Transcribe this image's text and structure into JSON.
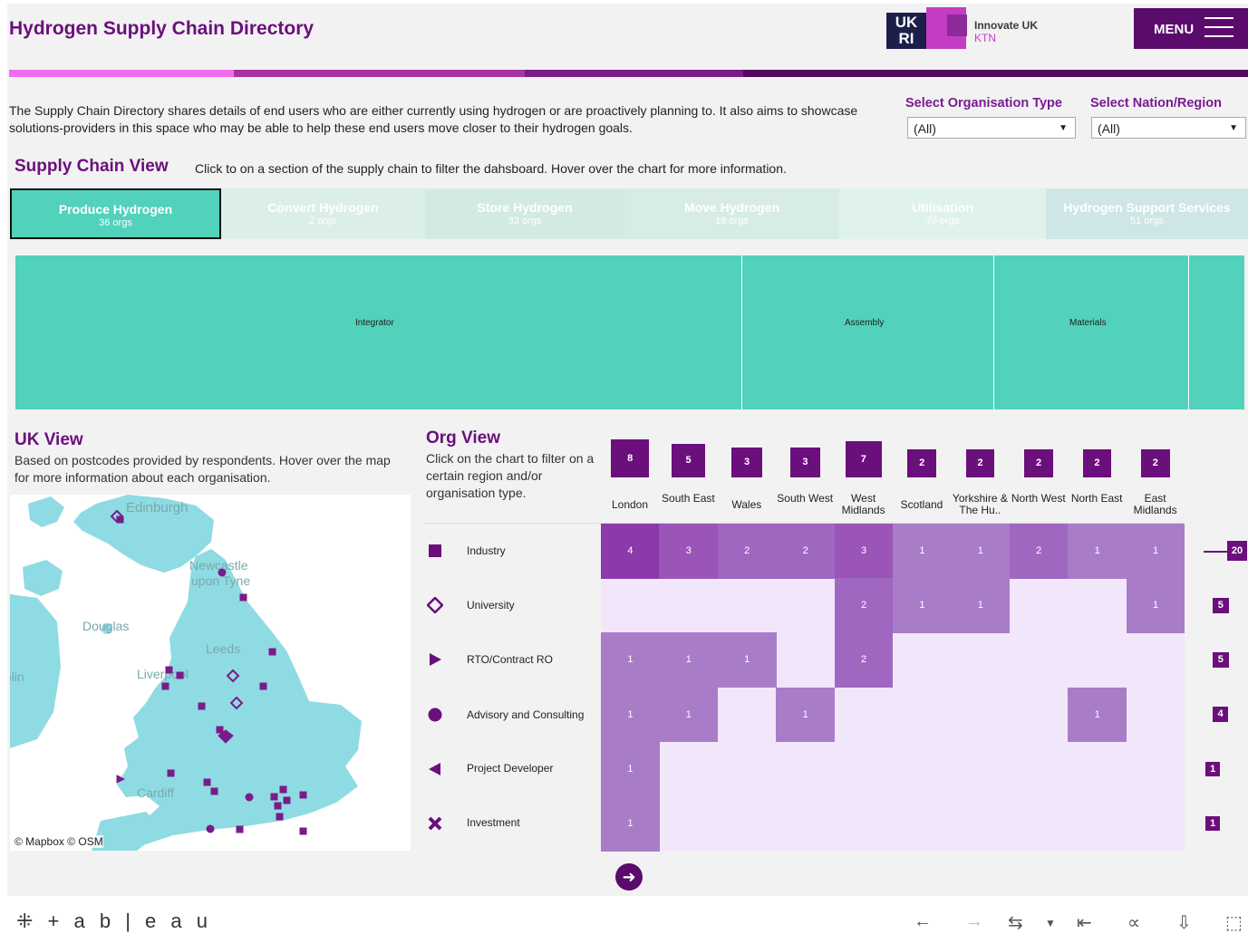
{
  "header": {
    "title": "Hydrogen Supply Chain Directory",
    "logo_text": "UK RI",
    "logo_name": "Innovate UK",
    "logo_sub": "KTN",
    "menu_label": "MENU"
  },
  "colors": {
    "accent": "#6b0f7c",
    "teal": "#52d1bb",
    "stripe": [
      "#f26cf0",
      "#b03cb8",
      "#8a2095",
      "#55095f"
    ]
  },
  "intro": {
    "text": "The Supply Chain Directory shares details of end users who are either currently using hydrogen or are proactively planning to. It also aims to showcase solutions-providers in this space who may be able to help these end users move closer to their hydrogen goals."
  },
  "filters": {
    "org_type": {
      "label": "Select Organisation Type",
      "value": "(All)"
    },
    "nation": {
      "label": "Select Nation/Region",
      "value": "(All)"
    }
  },
  "supply_chain": {
    "title": "Supply Chain View",
    "description": "Click to on a section of the supply chain to filter the dahsboard. Hover over the chart for more information.",
    "tabs": [
      {
        "label": "Produce Hydrogen",
        "count": "36 orgs",
        "selected": true,
        "color": "#52d1bb"
      },
      {
        "label": "Convert Hydrogen",
        "count": "2 orgs",
        "color": "#dceee9"
      },
      {
        "label": "Store Hydrogen",
        "count": "33 orgs",
        "color": "#d3eae4"
      },
      {
        "label": "Move Hydrogen",
        "count": "18 orgs",
        "color": "#d8ece7"
      },
      {
        "label": "Utilisation",
        "count": "70 orgs",
        "color": "#dff2ee"
      },
      {
        "label": "Hydrogen Support Services",
        "count": "51 orgs",
        "color": "#cfe6e6"
      }
    ],
    "treemap": [
      {
        "label": "Integrator"
      },
      {
        "label": "Assembly"
      },
      {
        "label": "Materials"
      },
      {
        "label": ""
      }
    ]
  },
  "uk_view": {
    "title": "UK View",
    "description": "Based on postcodes provided by respondents. Hover over the map for more information about each organisation.",
    "places": [
      "Edinburgh",
      "Newcastle",
      "upon Tyne",
      "Douglas",
      "Leeds",
      "Liverpool",
      "Dublin",
      "Cardiff"
    ],
    "credit": "© Mapbox  © OSM"
  },
  "org_view": {
    "title": "Org View",
    "description": "Click on the chart to filter on a certain region and/or organisation type.",
    "regions": [
      {
        "name": "London",
        "total": 8
      },
      {
        "name": "South East",
        "total": 5
      },
      {
        "name": "Wales",
        "total": 3
      },
      {
        "name": "South West",
        "total": 3
      },
      {
        "name": "West Midlands",
        "total": 7
      },
      {
        "name": "Scotland",
        "total": 2
      },
      {
        "name": "Yorkshire & The Hu..",
        "total": 2
      },
      {
        "name": "North West",
        "total": 2
      },
      {
        "name": "North East",
        "total": 2
      },
      {
        "name": "East Midlands",
        "total": 2
      }
    ],
    "org_types": [
      {
        "name": "Industry",
        "icon": "square-icon",
        "total": 20,
        "values": [
          4,
          3,
          2,
          2,
          3,
          1,
          1,
          2,
          1,
          1
        ]
      },
      {
        "name": "University",
        "icon": "diamond-icon",
        "total": 5,
        "values": [
          null,
          null,
          null,
          null,
          2,
          1,
          1,
          null,
          null,
          1
        ]
      },
      {
        "name": "RTO/Contract RO",
        "icon": "triangle-right-icon",
        "total": 5,
        "values": [
          1,
          1,
          1,
          null,
          2,
          null,
          null,
          null,
          null,
          null
        ]
      },
      {
        "name": "Advisory and Consulting",
        "icon": "circle-icon",
        "total": 4,
        "values": [
          1,
          1,
          null,
          1,
          null,
          null,
          null,
          null,
          1,
          null
        ]
      },
      {
        "name": "Project Developer",
        "icon": "triangle-left-icon",
        "total": 1,
        "values": [
          1,
          null,
          null,
          null,
          null,
          null,
          null,
          null,
          null,
          null
        ]
      },
      {
        "name": "Investment",
        "icon": "cross-icon",
        "total": 1,
        "values": [
          1,
          null,
          null,
          null,
          null,
          null,
          null,
          null,
          null,
          null
        ]
      }
    ]
  },
  "footer": {
    "brand": "+ a b | e a u"
  }
}
